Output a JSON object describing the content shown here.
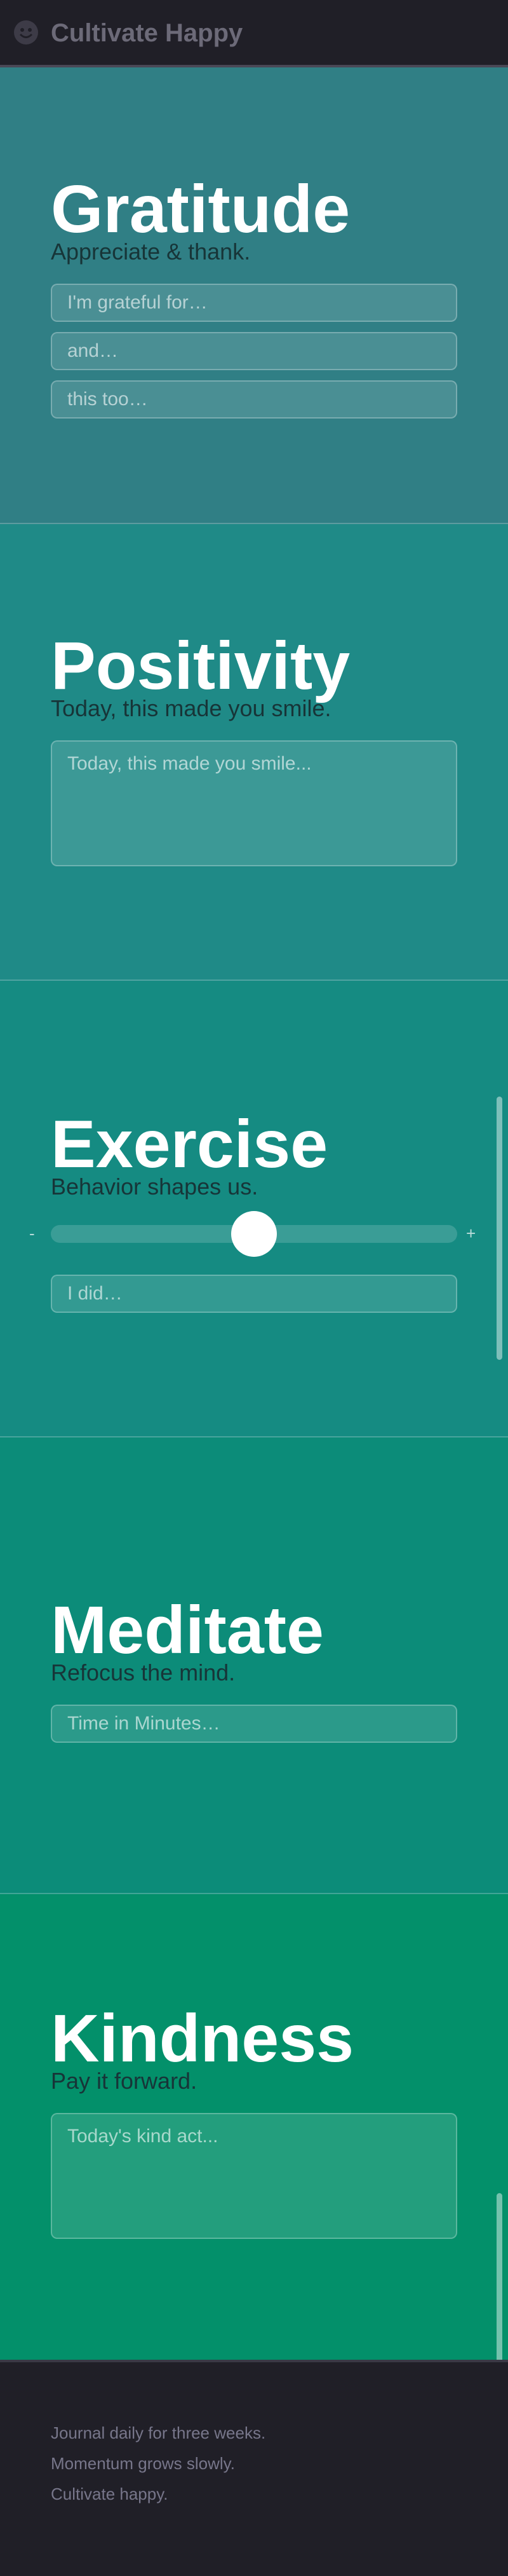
{
  "header": {
    "brand": "Cultivate Happy",
    "logo_icon": "smiley-icon"
  },
  "sections": [
    {
      "title": "Gratitude",
      "subtitle": "Appreciate & thank.",
      "background": "#307f85",
      "fields": [
        {
          "placeholder": "I'm grateful for…"
        },
        {
          "placeholder": "and…"
        },
        {
          "placeholder": "this too…"
        }
      ]
    },
    {
      "title": "Positivity",
      "subtitle": "Today, this made you smile.",
      "background": "#1f8a87",
      "fields": [
        {
          "placeholder": "Today, this made you smile..."
        }
      ]
    },
    {
      "title": "Exercise",
      "subtitle": "Behavior shapes us.",
      "background": "#158b82",
      "slider": {
        "min_label": "-",
        "max_label": "+",
        "value": 0.5
      },
      "fields": [
        {
          "placeholder": "I did…"
        }
      ]
    },
    {
      "title": "Meditate",
      "subtitle": "Refocus the mind.",
      "background": "#0c8c79",
      "fields": [
        {
          "placeholder": "Time in Minutes…"
        }
      ]
    },
    {
      "title": "Kindness",
      "subtitle": "Pay it forward.",
      "background": "#03906a",
      "fields": [
        {
          "placeholder": "Today's kind act..."
        }
      ]
    }
  ],
  "footer": {
    "lines": [
      "Journal daily for three weeks.",
      "Momentum grows slowly.",
      "Cultivate happy."
    ]
  }
}
